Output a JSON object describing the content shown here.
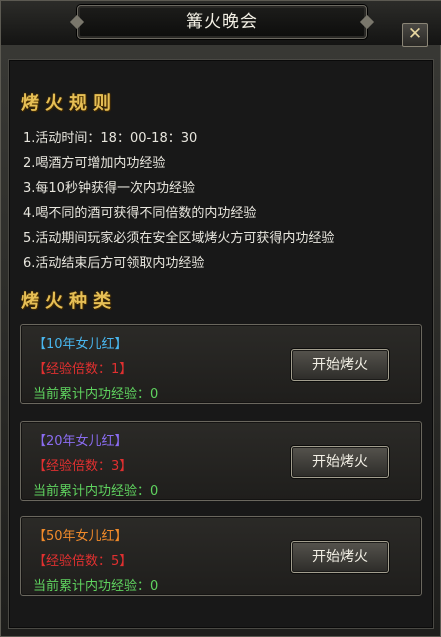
{
  "window": {
    "title": "篝火晚会",
    "close_icon": "close-icon"
  },
  "rules": {
    "title": "烤火规则",
    "items": [
      "1.活动时间：18：00-18：30",
      "2.喝酒方可增加内功经验",
      "3.每10秒钟获得一次内功经验",
      "4.喝不同的酒可获得不同倍数的内功经验",
      "5.活动期间玩家必须在安全区域烤火方可获得内功经验",
      "6.活动结束后方可领取内功经验"
    ]
  },
  "types": {
    "title": "烤火种类",
    "cards": [
      {
        "name": "【10年女儿红】",
        "name_color": "#49b6ee",
        "multiplier": "【经验倍数：1】",
        "exp": "当前累计内功经验：0",
        "button": "开始烤火"
      },
      {
        "name": "【20年女儿红】",
        "name_color": "#8a6cf0",
        "multiplier": "【经验倍数：3】",
        "exp": "当前累计内功经验：0",
        "button": "开始烤火"
      },
      {
        "name": "【50年女儿红】",
        "name_color": "#f08a2a",
        "multiplier": "【经验倍数：5】",
        "exp": "当前累计内功经验：0",
        "button": "开始烤火"
      }
    ]
  }
}
